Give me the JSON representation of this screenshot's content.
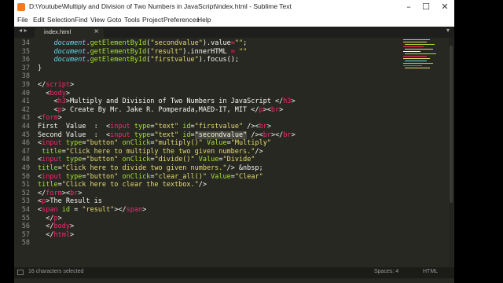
{
  "window": {
    "title": "D:\\Youtube\\Multiply and Division of Two Numbers in JavaScript\\index.html - Sublime Text",
    "controls": [
      "–",
      "☐",
      "✕"
    ]
  },
  "menu": [
    "File",
    "Edit",
    "Selection",
    "Find",
    "View",
    "Goto",
    "Tools",
    "Project",
    "Preferences",
    "Help"
  ],
  "tabs": [
    {
      "label": "index.html",
      "close": "×"
    }
  ],
  "nav": {
    "left": "◂ ▸",
    "right": "▾"
  },
  "editor": {
    "line_numbers": [
      "34",
      "35",
      "36",
      "37",
      "38",
      "39",
      "40",
      "41",
      "42",
      "43",
      "44",
      "45",
      "46",
      "47",
      "48",
      "49",
      "50",
      "51",
      "52",
      "53",
      "54",
      "55",
      "56",
      "57",
      "58"
    ],
    "lines": [
      [
        [
          "t-txt",
          "    "
        ],
        [
          "t-var",
          "document"
        ],
        [
          "t-txt",
          "."
        ],
        [
          "t-fn",
          "getElementById"
        ],
        [
          "t-txt",
          "("
        ],
        [
          "t-str",
          "\"secondvalue\""
        ],
        [
          "t-txt",
          ").value"
        ],
        [
          "t-op",
          "="
        ],
        [
          "t-str",
          "\"\""
        ],
        [
          "t-txt",
          ";"
        ]
      ],
      [
        [
          "t-txt",
          "    "
        ],
        [
          "t-var",
          "document"
        ],
        [
          "t-txt",
          "."
        ],
        [
          "t-fn",
          "getElementById"
        ],
        [
          "t-txt",
          "("
        ],
        [
          "t-str",
          "\"result\""
        ],
        [
          "t-txt",
          ").innerHTML "
        ],
        [
          "t-op",
          "="
        ],
        [
          "t-txt",
          " "
        ],
        [
          "t-str",
          "\"\""
        ]
      ],
      [
        [
          "t-txt",
          "    "
        ],
        [
          "t-var",
          "document"
        ],
        [
          "t-txt",
          "."
        ],
        [
          "t-fn",
          "getElementById"
        ],
        [
          "t-txt",
          "("
        ],
        [
          "t-str",
          "\"firstvalue\""
        ],
        [
          "t-txt",
          ").focus();"
        ]
      ],
      [
        [
          "t-txt",
          "}"
        ]
      ],
      [
        [
          "t-txt",
          ""
        ]
      ],
      [
        [
          "t-txt",
          "</"
        ],
        [
          "t-tag",
          "script"
        ],
        [
          "t-txt",
          ">"
        ]
      ],
      [
        [
          "t-txt",
          "  <"
        ],
        [
          "t-tag",
          "body"
        ],
        [
          "t-txt",
          ">"
        ]
      ],
      [
        [
          "t-txt",
          "    <"
        ],
        [
          "t-tag",
          "h3"
        ],
        [
          "t-txt",
          ">Multiply and Division of Two Numbers in JavaScript </"
        ],
        [
          "t-tag",
          "h3"
        ],
        [
          "t-txt",
          ">"
        ]
      ],
      [
        [
          "t-txt",
          "    <"
        ],
        [
          "t-tag",
          "p"
        ],
        [
          "t-txt",
          "> Create By Mr. Jake R. Pomperada,MAED-IT, MIT </"
        ],
        [
          "t-tag",
          "p"
        ],
        [
          "t-txt",
          "><"
        ],
        [
          "t-tag",
          "br"
        ],
        [
          "t-txt",
          ">"
        ]
      ],
      [
        [
          "t-txt",
          "<"
        ],
        [
          "t-tag",
          "form"
        ],
        [
          "t-txt",
          ">"
        ]
      ],
      [
        [
          "t-txt",
          "First  Value  :  <"
        ],
        [
          "t-tag",
          "input"
        ],
        [
          "t-txt",
          " "
        ],
        [
          "t-attr",
          "type"
        ],
        [
          "t-txt",
          "="
        ],
        [
          "t-str",
          "\"text\""
        ],
        [
          "t-txt",
          " "
        ],
        [
          "t-attr",
          "id"
        ],
        [
          "t-txt",
          "="
        ],
        [
          "t-str",
          "\"firstvalue\""
        ],
        [
          "t-txt",
          " /><"
        ],
        [
          "t-tag",
          "br"
        ],
        [
          "t-txt",
          ">"
        ]
      ],
      [
        [
          "t-txt",
          "Second Value  :  <"
        ],
        [
          "t-tag",
          "input"
        ],
        [
          "t-txt",
          " "
        ],
        [
          "t-attr",
          "type"
        ],
        [
          "t-txt",
          "="
        ],
        [
          "t-str",
          "\"text\""
        ],
        [
          "t-txt",
          " "
        ],
        [
          "t-attr",
          "id"
        ],
        [
          "t-txt",
          "="
        ],
        [
          "t-sel",
          "\"secondvalue\""
        ],
        [
          "t-txt",
          " /><"
        ],
        [
          "t-tag",
          "br"
        ],
        [
          "t-txt",
          ">"
        ],
        [
          "t-txt",
          "</"
        ],
        [
          "t-tag",
          "br"
        ],
        [
          "t-txt",
          ">"
        ]
      ],
      [
        [
          "t-txt",
          "<"
        ],
        [
          "t-tag",
          "input"
        ],
        [
          "t-txt",
          " "
        ],
        [
          "t-attr",
          "type"
        ],
        [
          "t-txt",
          "="
        ],
        [
          "t-str",
          "\"button\""
        ],
        [
          "t-txt",
          " "
        ],
        [
          "t-attr",
          "onClick"
        ],
        [
          "t-txt",
          "="
        ],
        [
          "t-str",
          "\"multiply()\""
        ],
        [
          "t-txt",
          " "
        ],
        [
          "t-attr",
          "Value"
        ],
        [
          "t-txt",
          "="
        ],
        [
          "t-str",
          "\"Multiply\""
        ]
      ],
      [
        [
          "t-txt",
          " "
        ],
        [
          "t-attr",
          "title"
        ],
        [
          "t-txt",
          "="
        ],
        [
          "t-str",
          "\"Click here to multiply the two given numbers.\""
        ],
        [
          "t-txt",
          "/>"
        ]
      ],
      [
        [
          "t-txt",
          "<"
        ],
        [
          "t-tag",
          "input"
        ],
        [
          "t-txt",
          " "
        ],
        [
          "t-attr",
          "type"
        ],
        [
          "t-txt",
          "="
        ],
        [
          "t-str",
          "\"button\""
        ],
        [
          "t-txt",
          " "
        ],
        [
          "t-attr",
          "onClick"
        ],
        [
          "t-txt",
          "="
        ],
        [
          "t-str",
          "\"divide()\""
        ],
        [
          "t-txt",
          " "
        ],
        [
          "t-attr",
          "Value"
        ],
        [
          "t-txt",
          "="
        ],
        [
          "t-str",
          "\"Divide\""
        ]
      ],
      [
        [
          "t-attr",
          "title"
        ],
        [
          "t-txt",
          "="
        ],
        [
          "t-str",
          "\"Click here to divide two given numbers.\""
        ],
        [
          "t-txt",
          "/> &nbsp;"
        ]
      ],
      [
        [
          "t-txt",
          "<"
        ],
        [
          "t-tag",
          "input"
        ],
        [
          "t-txt",
          " "
        ],
        [
          "t-attr",
          "type"
        ],
        [
          "t-txt",
          "="
        ],
        [
          "t-str",
          "\"button\""
        ],
        [
          "t-txt",
          " "
        ],
        [
          "t-attr",
          "onClick"
        ],
        [
          "t-txt",
          "="
        ],
        [
          "t-str",
          "\"clear_all()\""
        ],
        [
          "t-txt",
          " "
        ],
        [
          "t-attr",
          "Value"
        ],
        [
          "t-txt",
          "="
        ],
        [
          "t-str",
          "\"Clear\""
        ]
      ],
      [
        [
          "t-attr",
          "title"
        ],
        [
          "t-txt",
          "="
        ],
        [
          "t-str",
          "\"Click here to clear the textbox.\""
        ],
        [
          "t-txt",
          "/>"
        ]
      ],
      [
        [
          "t-txt",
          "</"
        ],
        [
          "t-tag",
          "form"
        ],
        [
          "t-txt",
          "><"
        ],
        [
          "t-tag",
          "br"
        ],
        [
          "t-txt",
          ">"
        ]
      ],
      [
        [
          "t-txt",
          "<"
        ],
        [
          "t-tag",
          "p"
        ],
        [
          "t-txt",
          ">The Result is"
        ]
      ],
      [
        [
          "t-txt",
          "<"
        ],
        [
          "t-tag",
          "span"
        ],
        [
          "t-txt",
          " "
        ],
        [
          "t-attr",
          "id"
        ],
        [
          "t-txt",
          " = "
        ],
        [
          "t-str",
          "\"result\""
        ],
        [
          "t-txt",
          "></"
        ],
        [
          "t-tag",
          "span"
        ],
        [
          "t-txt",
          ">"
        ]
      ],
      [
        [
          "t-txt",
          "  </"
        ],
        [
          "t-tag",
          "p"
        ],
        [
          "t-txt",
          ">"
        ]
      ],
      [
        [
          "t-txt",
          "  </"
        ],
        [
          "t-tag",
          "body"
        ],
        [
          "t-txt",
          ">"
        ]
      ],
      [
        [
          "t-txt",
          "  </"
        ],
        [
          "t-tag",
          "html"
        ],
        [
          "t-txt",
          ">"
        ]
      ],
      [
        [
          "t-txt",
          ""
        ]
      ]
    ]
  },
  "status": {
    "selection": "16 characters selected",
    "spaces": "Spaces: 4",
    "syntax": "HTML"
  },
  "colors": {
    "background": "#272822",
    "tag": "#f92672",
    "attribute": "#a6e22e",
    "string": "#e6db74",
    "variable": "#66d9ef",
    "text": "#f8f8f2"
  }
}
